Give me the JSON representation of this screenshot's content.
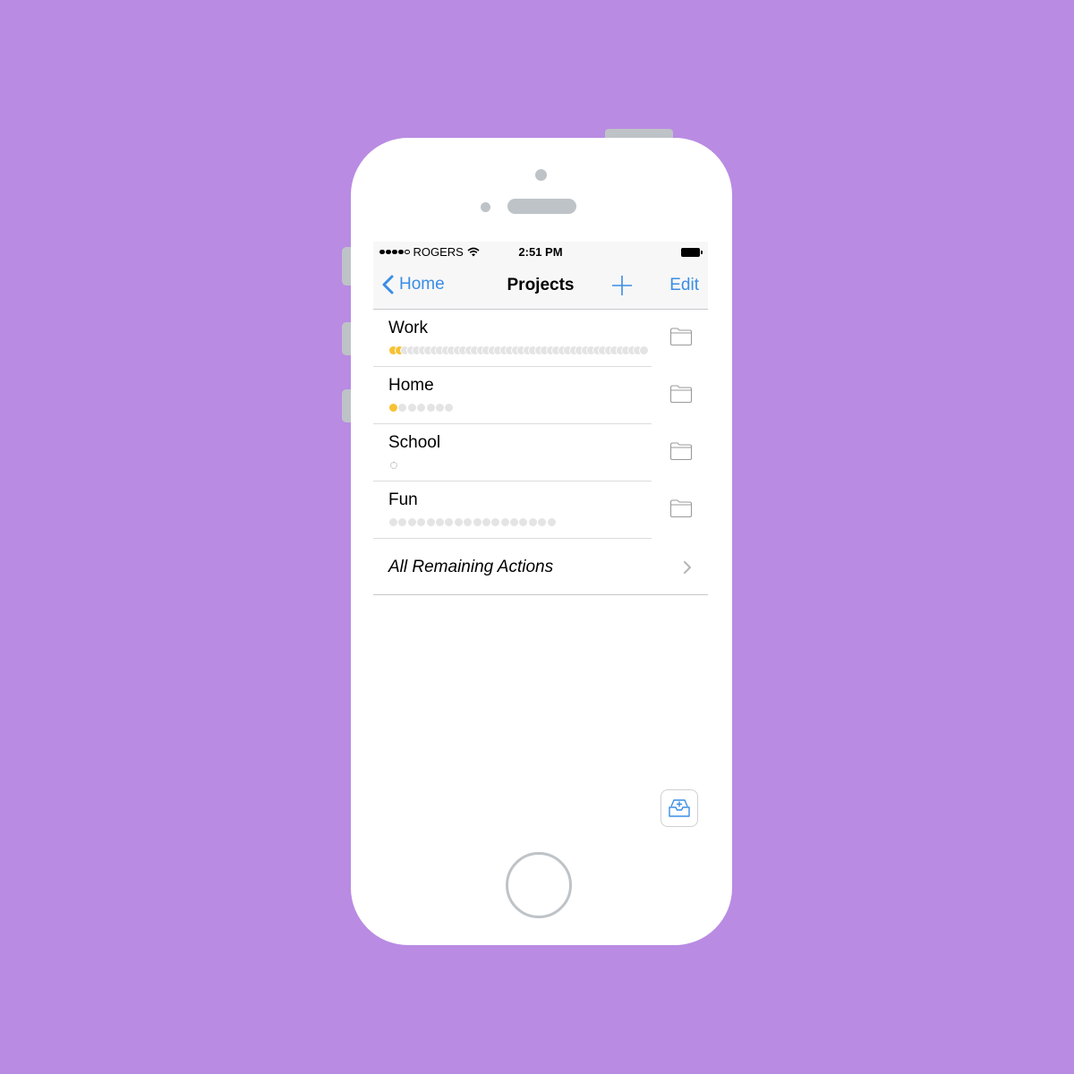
{
  "statusbar": {
    "signal_bars_filled": 4,
    "signal_bars_total": 5,
    "carrier": "ROGERS",
    "wifi_icon": "wifi-icon",
    "time": "2:51 PM",
    "battery_icon": "battery-full-icon"
  },
  "navbar": {
    "back_label": "Home",
    "back_icon": "chevron-left-icon",
    "title": "Projects",
    "add_icon": "plus-icon",
    "edit_label": "Edit"
  },
  "projects": [
    {
      "name": "Work",
      "completed": 2,
      "total": 44,
      "style": "dense",
      "icon": "folder-icon"
    },
    {
      "name": "Home",
      "completed": 1,
      "total": 7,
      "style": "normal",
      "icon": "folder-icon"
    },
    {
      "name": "School",
      "completed": 0,
      "total": 0,
      "style": "empty",
      "icon": "folder-icon"
    },
    {
      "name": "Fun",
      "completed": 0,
      "total": 18,
      "style": "normal",
      "icon": "folder-icon"
    }
  ],
  "all_remaining": {
    "label": "All Remaining Actions",
    "icon": "chevron-right-icon"
  },
  "inbox_button": {
    "icon": "inbox-add-icon"
  },
  "colors": {
    "background": "#b98be3",
    "accent": "#3b8de6",
    "progress_done": "#f7c233",
    "progress_todo": "#e4e4e4",
    "device_gray": "#bec3c7"
  }
}
